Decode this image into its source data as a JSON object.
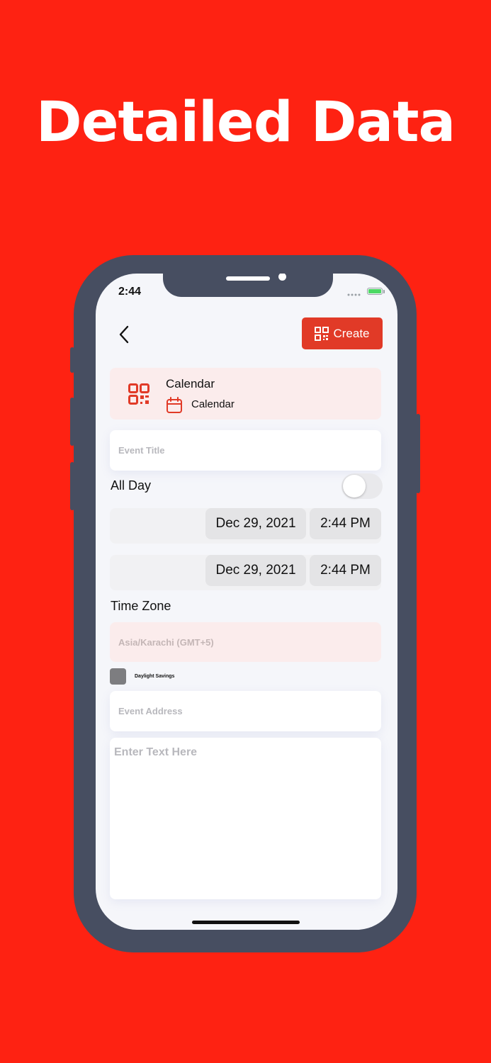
{
  "headline": "Detailed Data",
  "status_bar": {
    "time": "2:44"
  },
  "nav": {
    "create_label": "Create"
  },
  "card": {
    "title": "Calendar",
    "subtitle": "Calendar"
  },
  "form": {
    "event_title_placeholder": "Event Title",
    "all_day_label": "All Day",
    "all_day_on": false,
    "start_date": "Dec 29, 2021",
    "start_time": "2:44 PM",
    "end_date": "Dec 29, 2021",
    "end_time": "2:44 PM",
    "time_zone_label": "Time Zone",
    "time_zone_value": "Asia/Karachi (GMT+5)",
    "daylight_savings_label": "Daylight Savings",
    "event_address_placeholder": "Event Address",
    "notes_placeholder": "Enter Text Here"
  },
  "colors": {
    "background": "#fe2212",
    "accent": "#e13a27",
    "phone_frame": "#474e61",
    "card_tint": "#fbecec"
  }
}
